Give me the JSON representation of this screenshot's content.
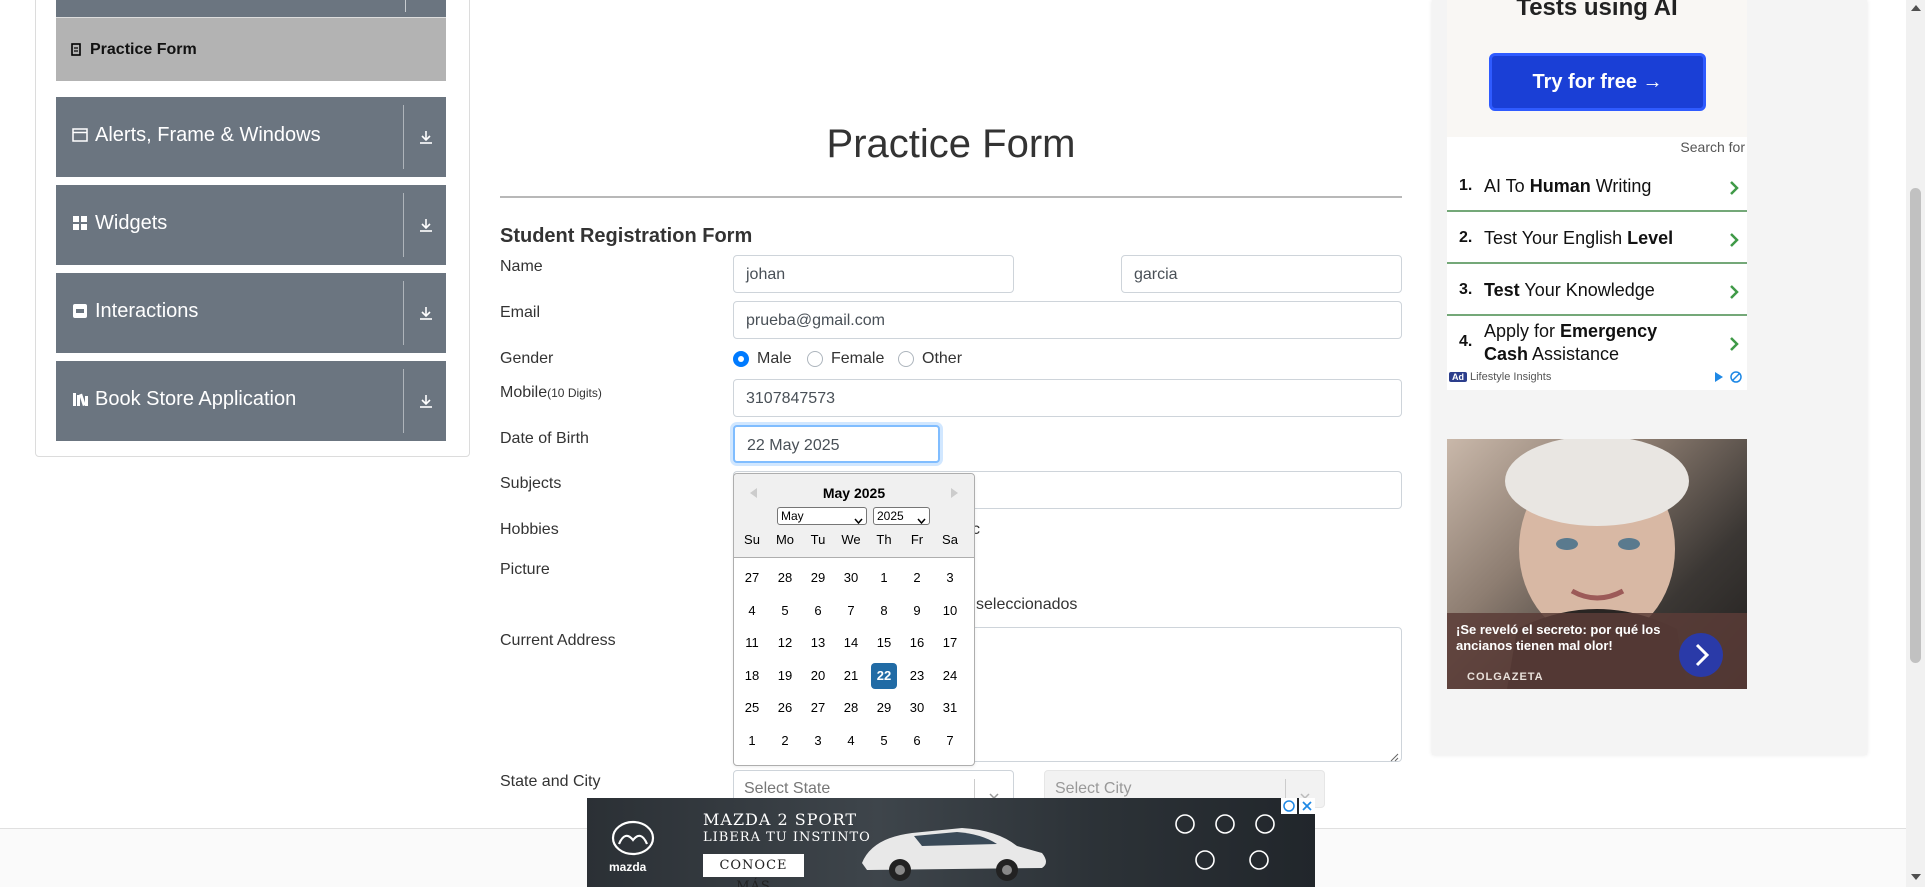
{
  "sidebar": {
    "active_item": "Practice Form",
    "groups": [
      {
        "label": "Alerts, Frame & Windows",
        "icon": "window-icon"
      },
      {
        "label": "Widgets",
        "icon": "widgets-icon"
      },
      {
        "label": "Interactions",
        "icon": "interactions-icon"
      },
      {
        "label": "Book Store Application",
        "icon": "books-icon"
      }
    ]
  },
  "form": {
    "title": "Practice Form",
    "subtitle": "Student Registration Form",
    "labels": {
      "name": "Name",
      "email": "Email",
      "gender": "Gender",
      "mobile": "Mobile",
      "mobile_hint": "(10 Digits)",
      "dob": "Date of Birth",
      "subjects": "Subjects",
      "hobbies": "Hobbies",
      "picture": "Picture",
      "address": "Current Address",
      "state_city": "State and City"
    },
    "first_name": "johan",
    "last_name": "garcia",
    "email": "prueba@gmail.com",
    "gender_options": [
      "Male",
      "Female",
      "Other"
    ],
    "gender_selected": "Male",
    "mobile": "3107847573",
    "dob": "22 May 2025",
    "hobby_fragment": "c",
    "picture_status": "seleccionados",
    "state_placeholder": "Select State",
    "city_placeholder": "Select City"
  },
  "datepicker": {
    "header": "May 2025",
    "month_select": "May",
    "year_select": "2025",
    "day_names": [
      "Su",
      "Mo",
      "Tu",
      "We",
      "Th",
      "Fr",
      "Sa"
    ],
    "weeks": [
      [
        "27",
        "28",
        "29",
        "30",
        "1",
        "2",
        "3"
      ],
      [
        "4",
        "5",
        "6",
        "7",
        "8",
        "9",
        "10"
      ],
      [
        "11",
        "12",
        "13",
        "14",
        "15",
        "16",
        "17"
      ],
      [
        "18",
        "19",
        "20",
        "21",
        "22",
        "23",
        "24"
      ],
      [
        "25",
        "26",
        "27",
        "28",
        "29",
        "30",
        "31"
      ],
      [
        "1",
        "2",
        "3",
        "4",
        "5",
        "6",
        "7"
      ]
    ],
    "selected_day": "22"
  },
  "right_ads": {
    "top_heading": "Tests using AI",
    "try_button": "Try for free →",
    "search_for": "Search for",
    "items": [
      {
        "num": "1.",
        "pre": "AI To ",
        "bold": "Human",
        "post": " Writing"
      },
      {
        "num": "2.",
        "pre": "Test Your English ",
        "bold": "Level",
        "post": ""
      },
      {
        "num": "3.",
        "pre": "",
        "bold": "Test",
        "post": " Your Knowledge"
      },
      {
        "num": "4.",
        "pre": "Apply for ",
        "bold": "Emergency Cash",
        "post": " Assistance"
      }
    ],
    "ad_badge": "Ad",
    "ad_source": "Lifestyle Insights",
    "photo_caption": "¡Se reveló el secreto: por qué los ancianos tienen mal olor!",
    "photo_brand": "COLGAZETA"
  },
  "banner": {
    "brand": "mazda",
    "headline": "MAZDA 2 SPORT",
    "subhead": "LIBERA TU INSTINTO",
    "cta": "CONOCE MÁS"
  },
  "colors": {
    "nav_gray": "#6b7580",
    "active_gray": "#b3b3b3",
    "radio_blue": "#007bff",
    "selected_day_blue": "#216ba5",
    "try_button_blue": "#1a3fd6"
  }
}
